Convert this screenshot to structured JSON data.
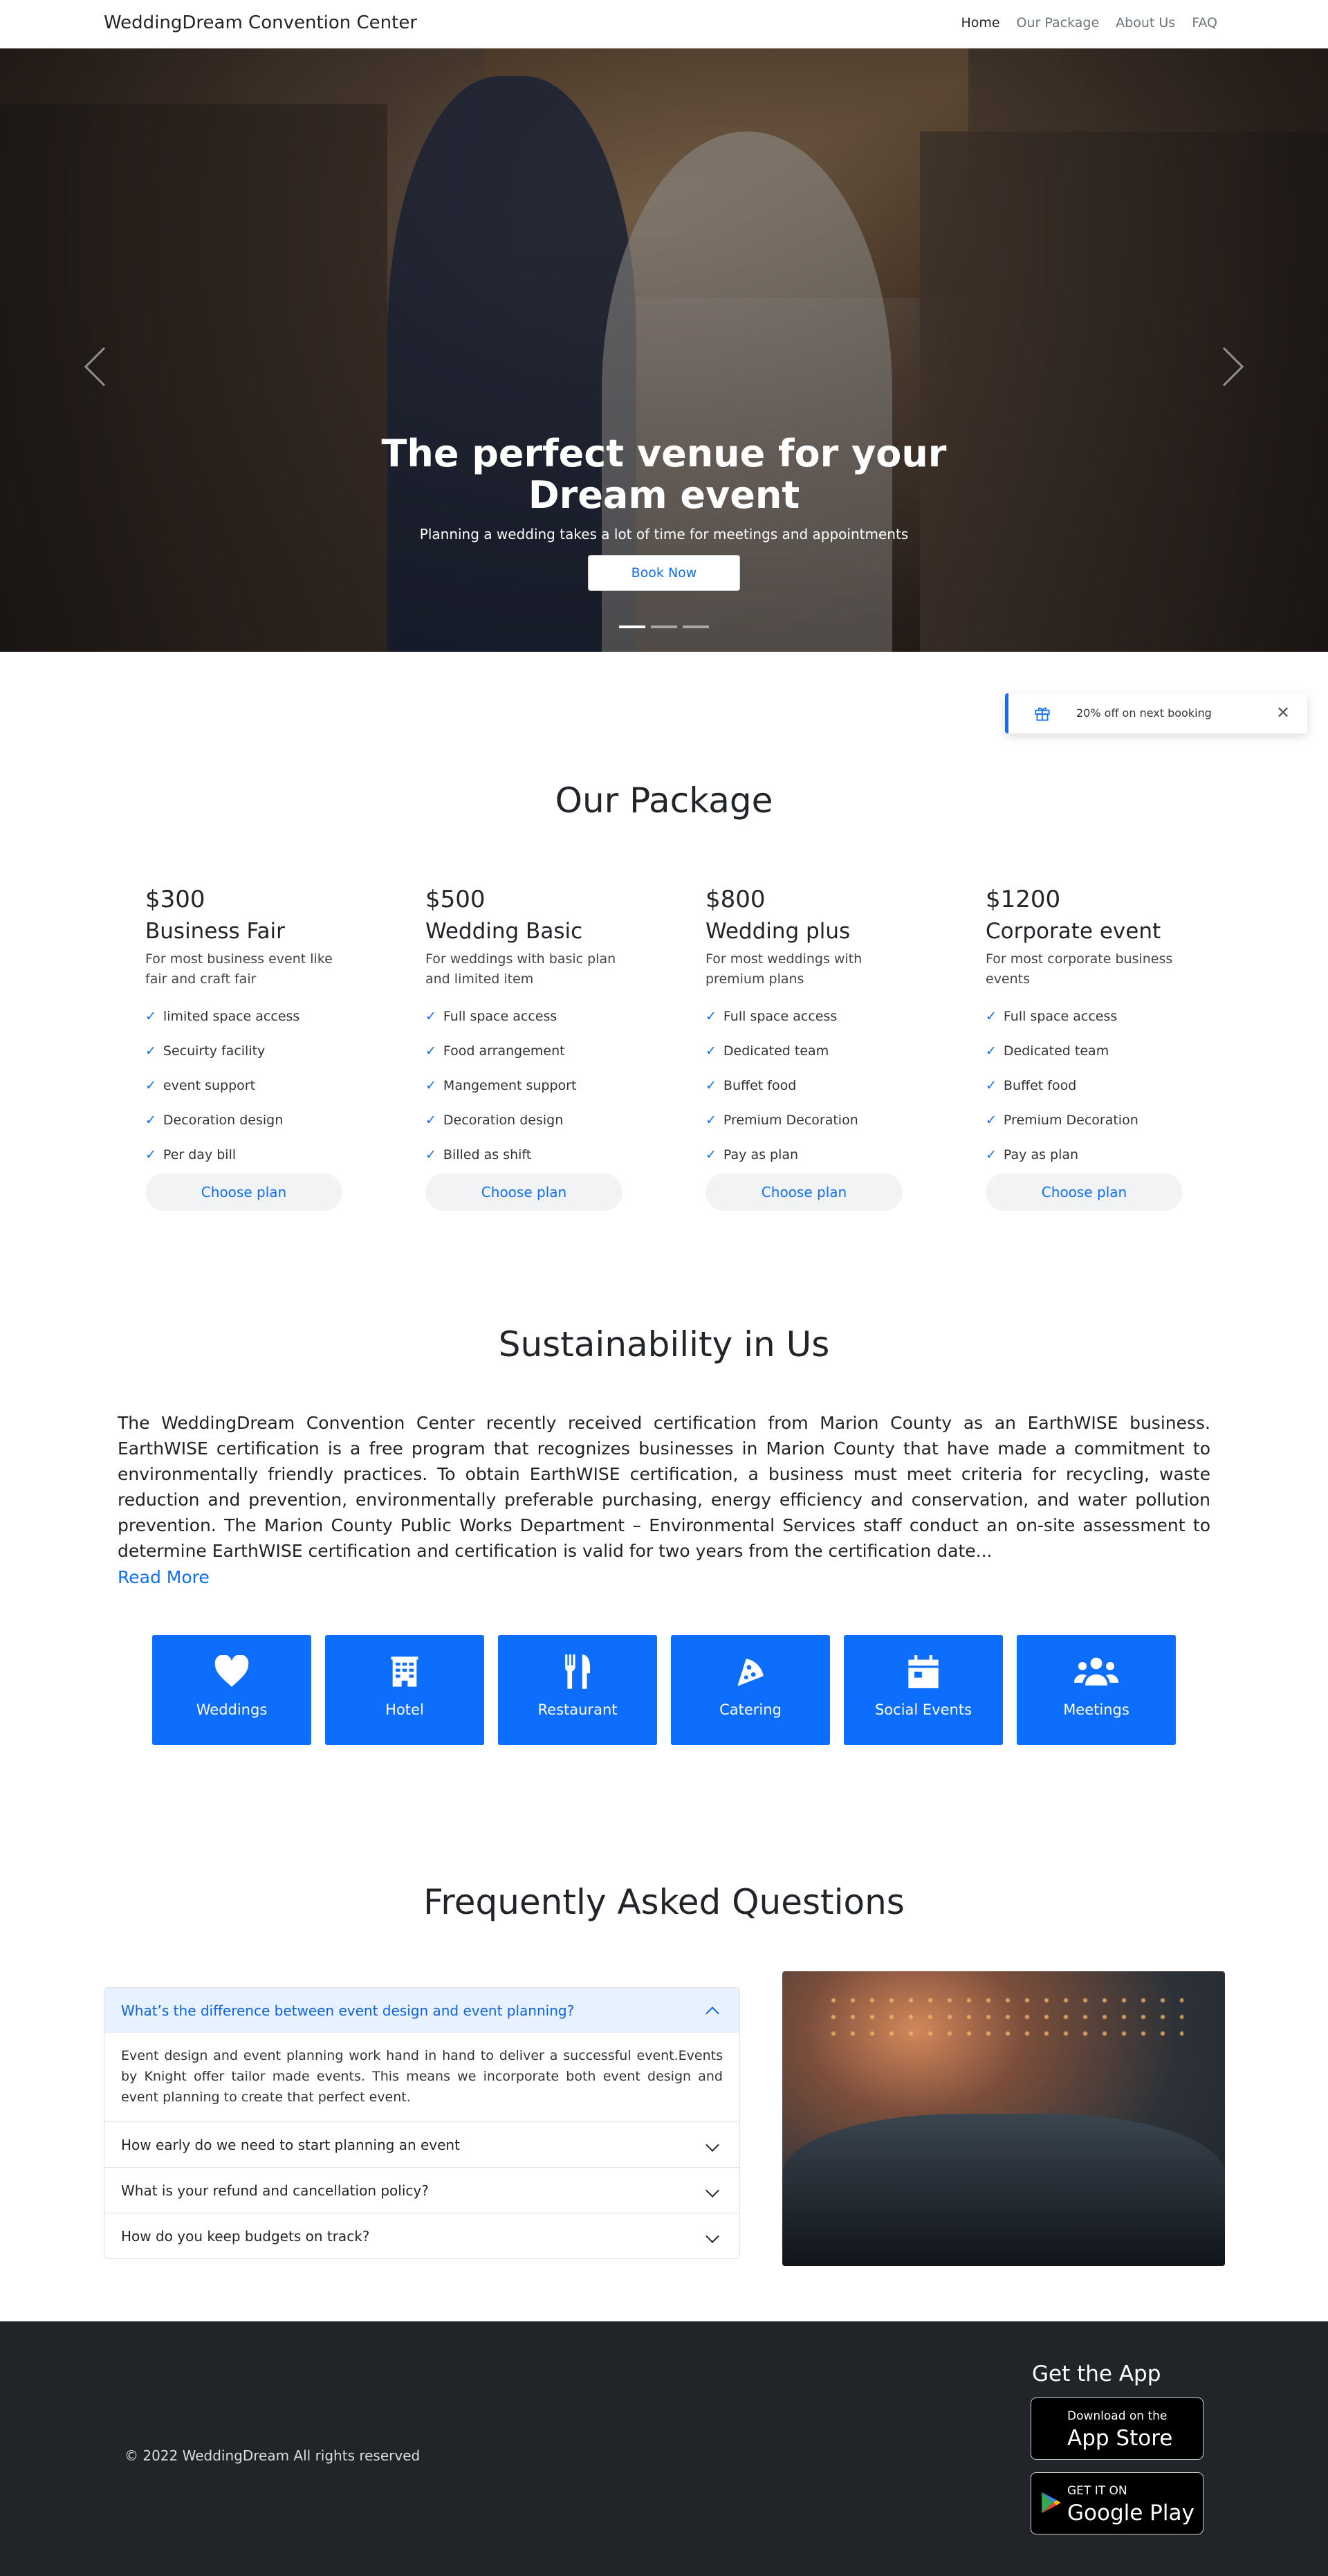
{
  "navbar": {
    "brand": "WeddingDream Convention Center",
    "links": [
      "Home",
      "Our Package",
      "About Us",
      "FAQ"
    ]
  },
  "hero": {
    "title_line1": "The perfect venue for your",
    "title_line2": "Dream event",
    "subtitle": "Planning a wedding takes a lot of time for meetings and appointments",
    "cta": "Book Now",
    "slides": 3,
    "active_slide": 1
  },
  "toast": {
    "message": "20% off on next booking",
    "icon": "gift-icon",
    "close_icon": "close-icon"
  },
  "packages": {
    "title": "Our Package",
    "items": [
      {
        "price": "$300",
        "name": "Business Fair",
        "desc": "For most business event like fair and craft fair",
        "features": [
          "limited space access",
          "Secuirty facility",
          "event support",
          "Decoration design",
          "Per day bill"
        ],
        "cta": "Choose plan"
      },
      {
        "price": "$500",
        "name": "Wedding Basic",
        "desc": "For weddings with basic plan and limited item",
        "features": [
          "Full space access",
          "Food arrangement",
          "Mangement support",
          "Decoration design",
          "Billed as shift"
        ],
        "cta": "Choose plan"
      },
      {
        "price": "$800",
        "name": "Wedding plus",
        "desc": "For most weddings with premium plans",
        "features": [
          "Full space access",
          "Dedicated team",
          "Buffet food",
          "Premium Decoration",
          "Pay as plan"
        ],
        "cta": "Choose plan"
      },
      {
        "price": "$1200",
        "name": "Corporate event",
        "desc": "For most corporate business events",
        "features": [
          "Full space access",
          "Dedicated team",
          "Buffet food",
          "Premium Decoration",
          "Pay as plan"
        ],
        "cta": "Choose plan"
      }
    ]
  },
  "sustainability": {
    "title": "Sustainability in Us",
    "text": "The WeddingDream Convention Center recently received certification from Marion County as an EarthWISE business. EarthWISE certification is a free program that recognizes businesses in Marion County that have made a commitment to environmentally friendly practices. To obtain EarthWISE certification, a business must meet criteria for recycling, waste reduction and prevention, environmentally preferable purchasing, energy efficiency and conservation, and water pollution prevention. The Marion County Public Works Department – Environmental Services staff conduct an on-site assessment to determine EarthWISE certification and certification is valid for two years from the certification date...",
    "read_more": "Read More"
  },
  "services": [
    {
      "label": "Weddings",
      "icon": "heart-icon"
    },
    {
      "label": "Hotel",
      "icon": "hotel-icon"
    },
    {
      "label": "Restaurant",
      "icon": "utensils-icon"
    },
    {
      "label": "Catering",
      "icon": "pizza-icon"
    },
    {
      "label": "Social Events",
      "icon": "calendar-icon"
    },
    {
      "label": "Meetings",
      "icon": "users-icon"
    }
  ],
  "faq": {
    "title": "Frequently Asked Questions",
    "items": [
      {
        "q": "What’s the difference between event design and event planning?",
        "a": "Event design and event planning work hand in hand to deliver a successful event.Events by Knight offer tailor made events. This means we incorporate both event design and event planning to create that perfect event.",
        "open": true
      },
      {
        "q": "How early do we need to start planning an event",
        "open": false
      },
      {
        "q": "What is your refund and cancellation policy?",
        "open": false
      },
      {
        "q": "How do you keep budgets on track?",
        "open": false
      }
    ]
  },
  "footer": {
    "copyright": "© 2022 WeddingDream All rights reserved",
    "get_app": "Get the App",
    "app_store_small": "Download on the",
    "app_store_big": "App Store",
    "google_small": "GET IT ON",
    "google_big": "Google Play"
  },
  "colors": {
    "accent": "#0d6efd",
    "footer_bg": "#212529",
    "faq_open_bg": "#e7f1ff"
  }
}
